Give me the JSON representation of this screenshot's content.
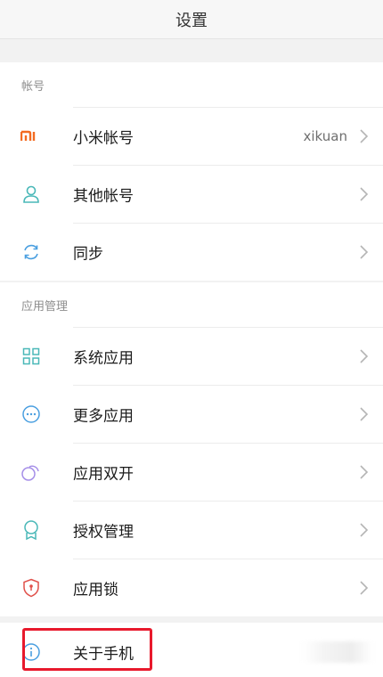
{
  "header": {
    "title": "设置"
  },
  "sections": [
    {
      "title": "帐号",
      "items": [
        {
          "label": "小米帐号",
          "value": "xikuan",
          "icon": "mi-logo-icon"
        },
        {
          "label": "其他帐号",
          "icon": "person-icon"
        },
        {
          "label": "同步",
          "icon": "sync-icon"
        }
      ]
    },
    {
      "title": "应用管理",
      "items": [
        {
          "label": "系统应用",
          "icon": "grid-icon"
        },
        {
          "label": "更多应用",
          "icon": "more-dots-icon"
        },
        {
          "label": "应用双开",
          "icon": "dual-app-icon"
        },
        {
          "label": "授权管理",
          "icon": "badge-icon"
        },
        {
          "label": "应用锁",
          "icon": "shield-lock-icon"
        }
      ]
    },
    {
      "items": [
        {
          "label": "关于手机",
          "icon": "info-icon"
        }
      ]
    }
  ],
  "colors": {
    "accent_orange": "#f36b21",
    "icon_teal": "#4ab8b8",
    "icon_blue": "#4a9fe0",
    "icon_purple": "#a58ee8",
    "icon_red": "#e0504a",
    "highlight_red": "#e8192c"
  }
}
